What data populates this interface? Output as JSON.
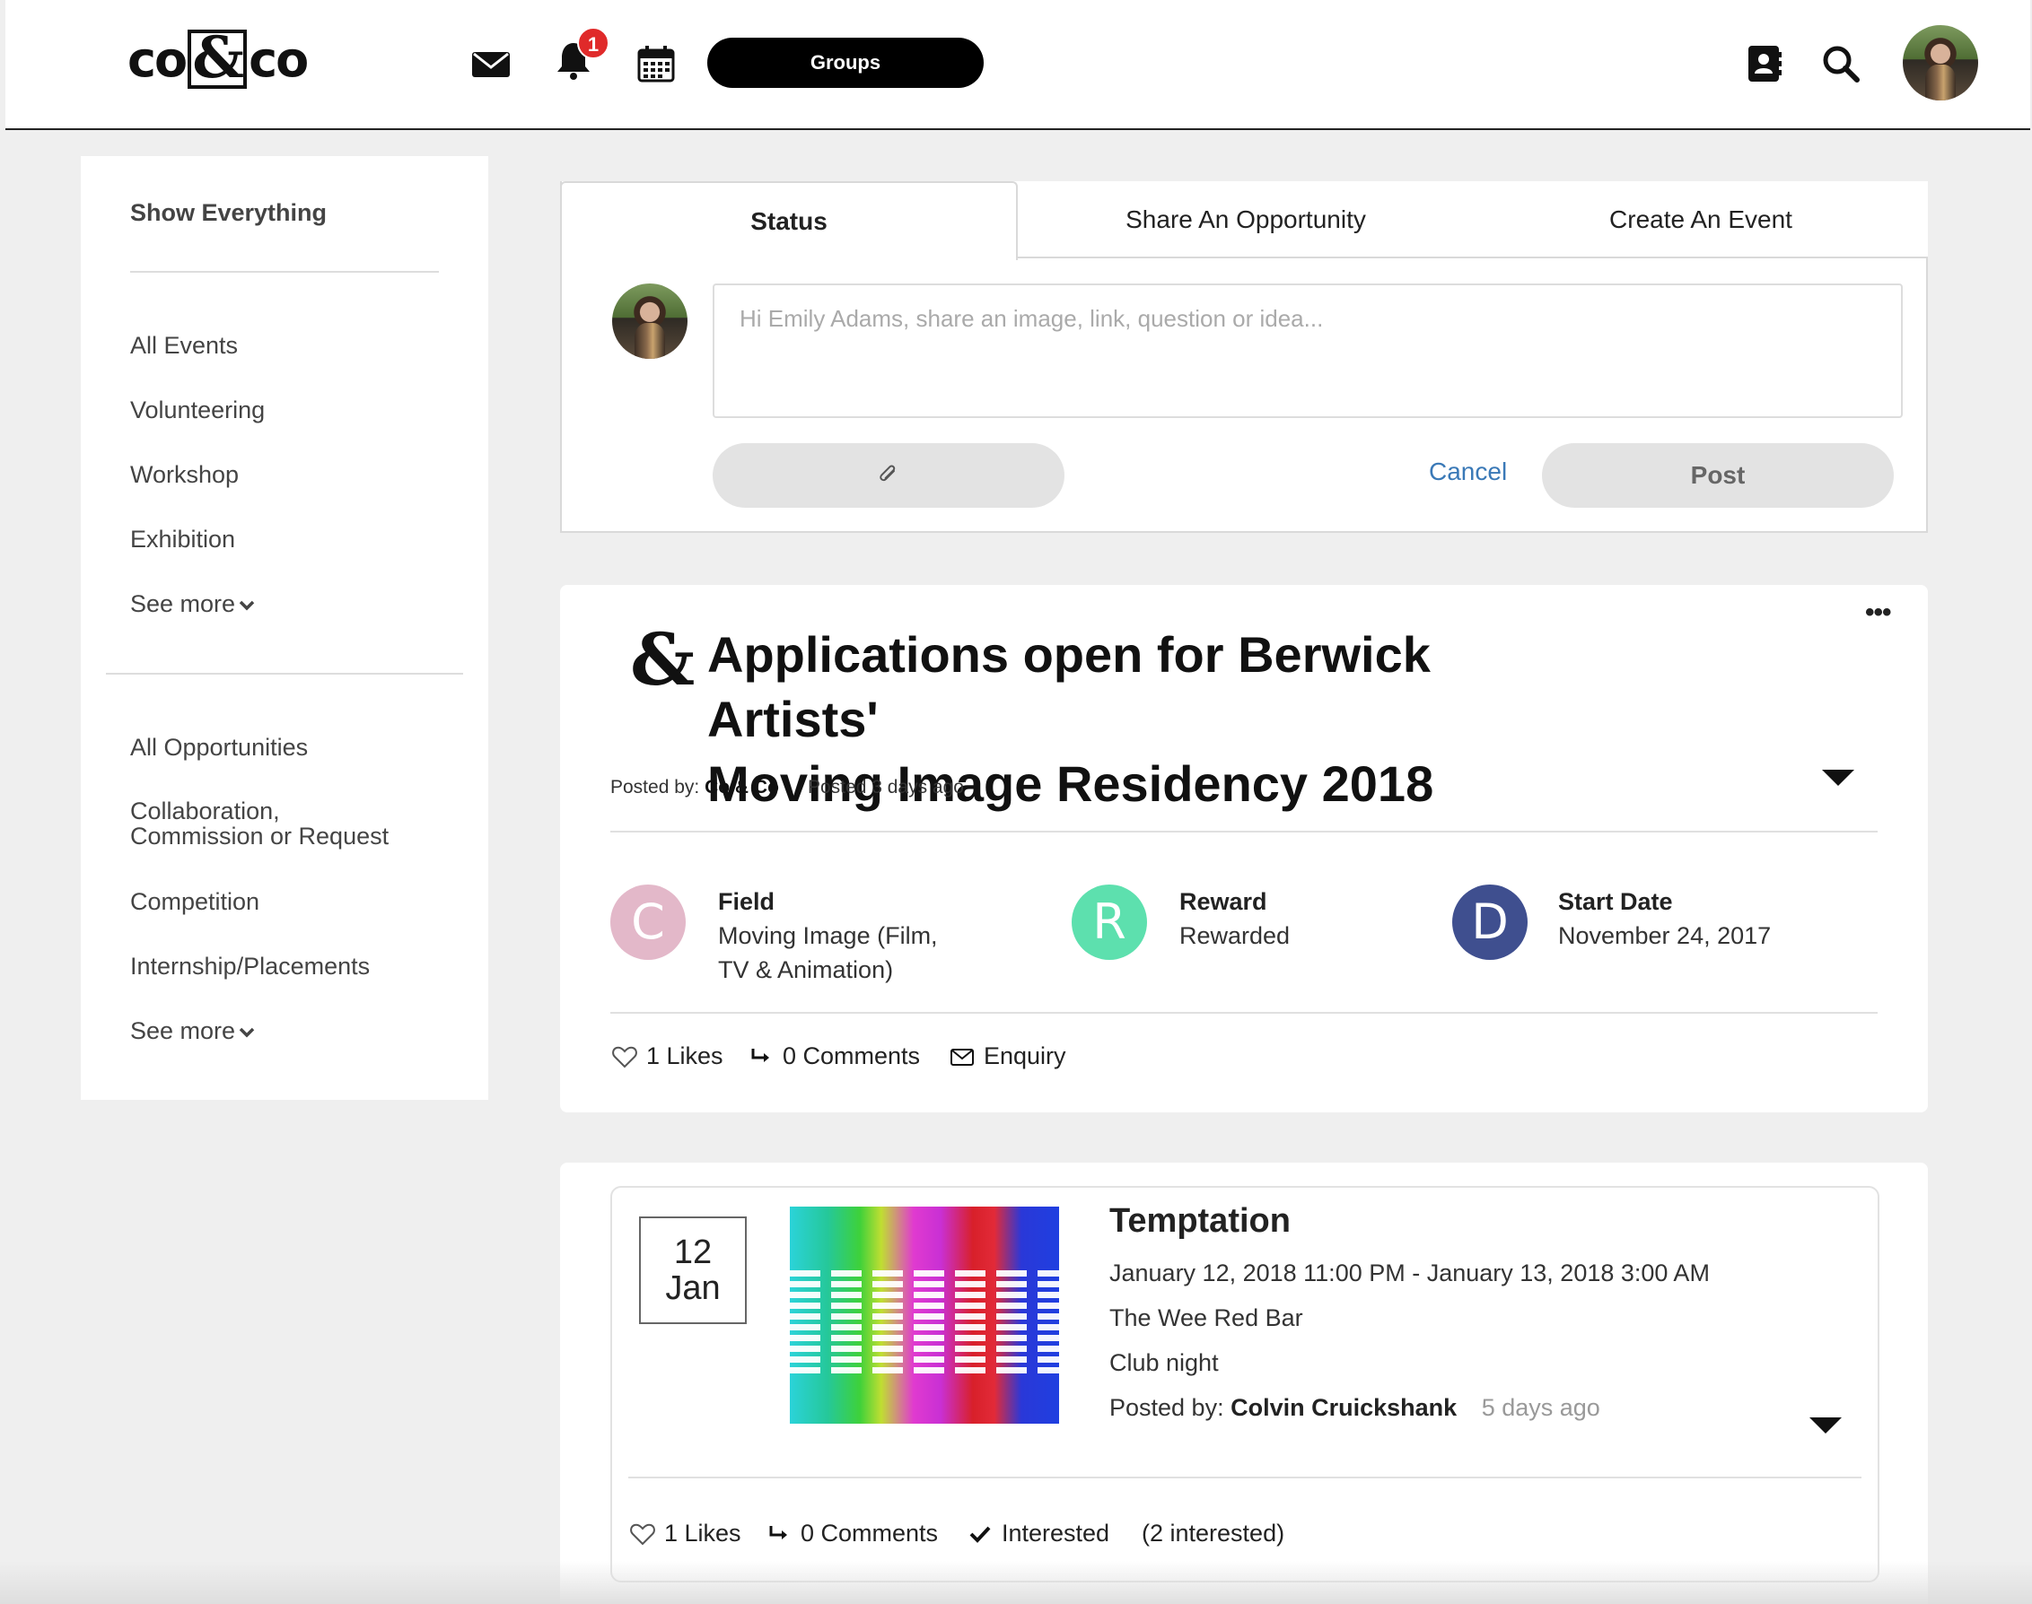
{
  "header": {
    "logo_left": "co",
    "logo_amp": "&",
    "logo_right": "co",
    "notification_count": "1",
    "groups_label": "Groups"
  },
  "sidebar": {
    "show_everything": "Show Everything",
    "events": [
      "All Events",
      "Volunteering",
      "Workshop",
      "Exhibition"
    ],
    "events_see_more": "See more",
    "opportunities": [
      "All Opportunities",
      "Collaboration,",
      "Commission or Request",
      "Competition",
      "Internship/Placements"
    ],
    "opportunities_see_more": "See more"
  },
  "composer": {
    "tabs": [
      "Status",
      "Share An Opportunity",
      "Create An Event"
    ],
    "placeholder": "Hi Emily Adams, share an image, link, question or idea...",
    "cancel_label": "Cancel",
    "post_label": "Post"
  },
  "opportunity": {
    "title_line1": "Applications open for Berwick Artists'",
    "title_line2": "Moving Image Residency 2018",
    "posted_by_label": "Posted by:",
    "posted_by": "Co & Co",
    "posted_ago": "Posted 3 days ago",
    "facts": [
      {
        "initial": "C",
        "label": "Field",
        "value_line1": "Moving Image (Film,",
        "value_line2": "TV & Animation)",
        "color": "#e3b8c9"
      },
      {
        "initial": "R",
        "label": "Reward",
        "value_line1": "Rewarded",
        "value_line2": "",
        "color": "#5de0ae"
      },
      {
        "initial": "D",
        "label": "Start Date",
        "value_line1": "November 24, 2017",
        "value_line2": "",
        "color": "#3f4f8f"
      }
    ],
    "likes": "1 Likes",
    "comments": "0 Comments",
    "enquiry": "Enquiry"
  },
  "event": {
    "day": "12",
    "month": "Jan",
    "title": "Temptation",
    "datetime": "January 12, 2018 11:00 PM - January 13, 2018 3:00 AM",
    "venue": "The Wee Red Bar",
    "category": "Club night",
    "posted_by_label": "Posted by:",
    "posted_by": "Colvin Cruickshank",
    "posted_ago": "5 days ago",
    "likes": "1 Likes",
    "comments": "0 Comments",
    "interested": "Interested",
    "interested_count": "(2 interested)"
  }
}
